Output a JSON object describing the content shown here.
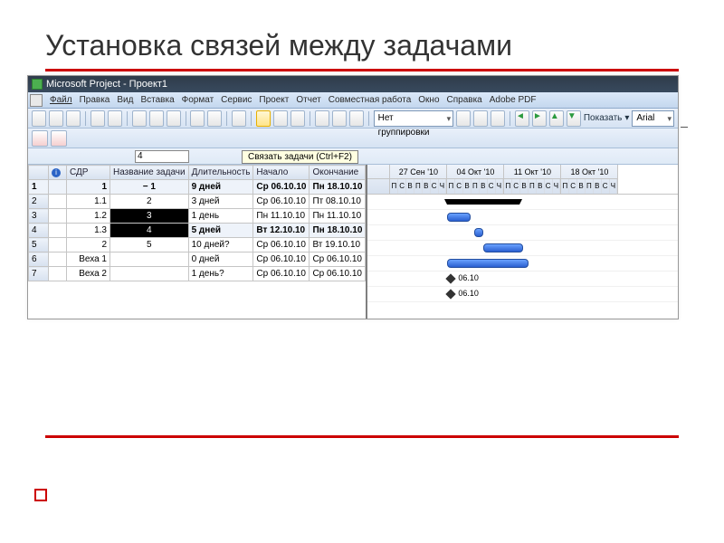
{
  "slide": {
    "title": "Установка связей между задачами"
  },
  "window": {
    "title": "Microsoft Project - Проект1"
  },
  "menu": [
    "Файл",
    "Правка",
    "Вид",
    "Вставка",
    "Формат",
    "Сервис",
    "Проект",
    "Отчет",
    "Совместная работа",
    "Окно",
    "Справка",
    "Adobe PDF"
  ],
  "toolbar": {
    "grouping": "Нет группировки",
    "show_label": "Показать",
    "font": "Arial"
  },
  "tooltip": "Связать задачи (Ctrl+F2)",
  "formula_value": "4",
  "columns": {
    "info": "",
    "wbs": "СДР",
    "name": "Название задачи",
    "duration": "Длительность",
    "start": "Начало",
    "end": "Окончание"
  },
  "rows": [
    {
      "n": "1",
      "wbs": "1",
      "name": "− 1",
      "dur": "9 дней",
      "start": "Ср 06.10.10",
      "end": "Пн 18.10.10",
      "bold": true
    },
    {
      "n": "2",
      "wbs": "1.1",
      "name": "2",
      "dur": "3 дней",
      "start": "Ср 06.10.10",
      "end": "Пт 08.10.10"
    },
    {
      "n": "3",
      "wbs": "1.2",
      "name": "3",
      "dur": "1 день",
      "start": "Пн 11.10.10",
      "end": "Пн 11.10.10",
      "sel": true
    },
    {
      "n": "4",
      "wbs": "1.3",
      "name": "4",
      "dur": "5 дней",
      "start": "Вт 12.10.10",
      "end": "Пн 18.10.10",
      "sel": true,
      "boldrow": true
    },
    {
      "n": "5",
      "wbs": "2",
      "name": "5",
      "dur": "10 дней?",
      "start": "Ср 06.10.10",
      "end": "Вт 19.10.10"
    },
    {
      "n": "6",
      "wbs": "Веха 1",
      "name": "",
      "dur": "0 дней",
      "start": "Ср 06.10.10",
      "end": "Ср 06.10.10"
    },
    {
      "n": "7",
      "wbs": "Веха 2",
      "name": "",
      "dur": "1 день?",
      "start": "Ср 06.10.10",
      "end": "Ср 06.10.10"
    }
  ],
  "timeline": {
    "weeks": [
      "27 Сен '10",
      "04 Окт '10",
      "11 Окт '10",
      "18 Окт '10"
    ],
    "days": "ПСВПВСЧ",
    "milestone_label": "06.10"
  }
}
